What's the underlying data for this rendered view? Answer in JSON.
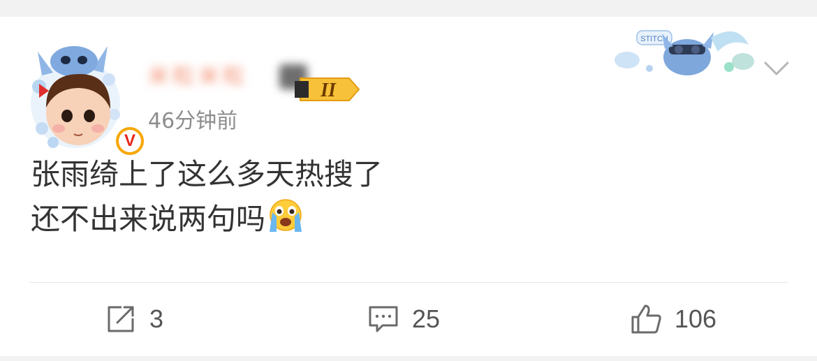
{
  "post": {
    "username": "米粒米粒",
    "level_badge": "II",
    "timestamp": "46分钟前",
    "text_lines": [
      "张雨绮上了这么多天热搜了",
      "还不出来说两句吗"
    ],
    "emoji": "crying-face",
    "sticker_text": "STITCH"
  },
  "actions": {
    "repost_count": "3",
    "comment_count": "25",
    "like_count": "106"
  },
  "colors": {
    "verified_badge": "#f7a600",
    "verified_v": "#e8261a",
    "text": "#333333",
    "meta": "#8d8d8d"
  }
}
